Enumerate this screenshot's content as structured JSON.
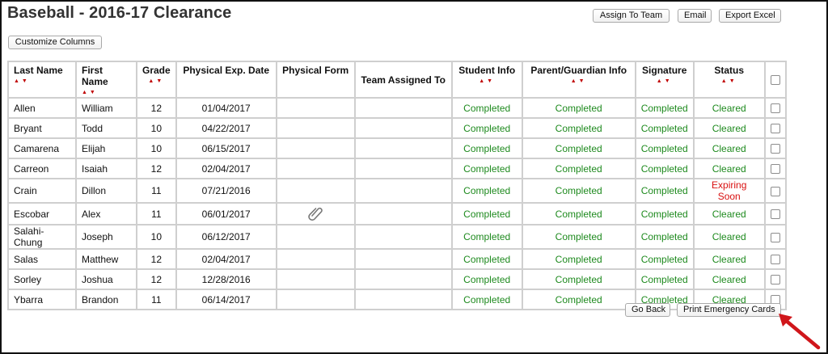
{
  "page": {
    "title": "Baseball - 2016-17 Clearance"
  },
  "toolbar": {
    "assign_label": "Assign To Team",
    "email_label": "Email",
    "export_label": "Export Excel",
    "customize_label": "Customize Columns"
  },
  "table": {
    "headers": {
      "last_name": "Last Name",
      "first_name": "First Name",
      "grade": "Grade",
      "physical_exp_date": "Physical Exp. Date",
      "physical_form": "Physical Form",
      "team_assigned": "Team Assigned To",
      "student_info": "Student Info",
      "parent_info": "Parent/Guardian Info",
      "signature": "Signature",
      "status": "Status"
    },
    "sort_icon": "sort-up-down-arrows",
    "attachment_icon": "paperclip-icon",
    "rows": [
      {
        "last": "Allen",
        "first": "William",
        "grade": "12",
        "exp": "01/04/2017",
        "form": "",
        "team": "",
        "student": "Completed",
        "parent": "Completed",
        "signature": "Completed",
        "status": "Cleared"
      },
      {
        "last": "Bryant",
        "first": "Todd",
        "grade": "10",
        "exp": "04/22/2017",
        "form": "",
        "team": "",
        "student": "Completed",
        "parent": "Completed",
        "signature": "Completed",
        "status": "Cleared"
      },
      {
        "last": "Camarena",
        "first": "Elijah",
        "grade": "10",
        "exp": "06/15/2017",
        "form": "",
        "team": "",
        "student": "Completed",
        "parent": "Completed",
        "signature": "Completed",
        "status": "Cleared"
      },
      {
        "last": "Carreon",
        "first": "Isaiah",
        "grade": "12",
        "exp": "02/04/2017",
        "form": "",
        "team": "",
        "student": "Completed",
        "parent": "Completed",
        "signature": "Completed",
        "status": "Cleared"
      },
      {
        "last": "Crain",
        "first": "Dillon",
        "grade": "11",
        "exp": "07/21/2016",
        "form": "",
        "team": "",
        "student": "Completed",
        "parent": "Completed",
        "signature": "Completed",
        "status": "Expiring Soon"
      },
      {
        "last": "Escobar",
        "first": "Alex",
        "grade": "11",
        "exp": "06/01/2017",
        "form": "attachment",
        "team": "",
        "student": "Completed",
        "parent": "Completed",
        "signature": "Completed",
        "status": "Cleared"
      },
      {
        "last": "Salahi-Chung",
        "first": "Joseph",
        "grade": "10",
        "exp": "06/12/2017",
        "form": "",
        "team": "",
        "student": "Completed",
        "parent": "Completed",
        "signature": "Completed",
        "status": "Cleared"
      },
      {
        "last": "Salas",
        "first": "Matthew",
        "grade": "12",
        "exp": "02/04/2017",
        "form": "",
        "team": "",
        "student": "Completed",
        "parent": "Completed",
        "signature": "Completed",
        "status": "Cleared"
      },
      {
        "last": "Sorley",
        "first": "Joshua",
        "grade": "12",
        "exp": "12/28/2016",
        "form": "",
        "team": "",
        "student": "Completed",
        "parent": "Completed",
        "signature": "Completed",
        "status": "Cleared"
      },
      {
        "last": "Ybarra",
        "first": "Brandon",
        "grade": "11",
        "exp": "06/14/2017",
        "form": "",
        "team": "",
        "student": "Completed",
        "parent": "Completed",
        "signature": "Completed",
        "status": "Cleared"
      }
    ]
  },
  "footer": {
    "back_label": "Go Back",
    "print_label": "Print Emergency Cards"
  },
  "colors": {
    "completed": "#1e8a1e",
    "cleared": "#1e8a1e",
    "expiring": "#d91010",
    "sort_arrow": "#c00000",
    "callout_arrow": "#d0161b",
    "grid": "#cfcfcf"
  }
}
